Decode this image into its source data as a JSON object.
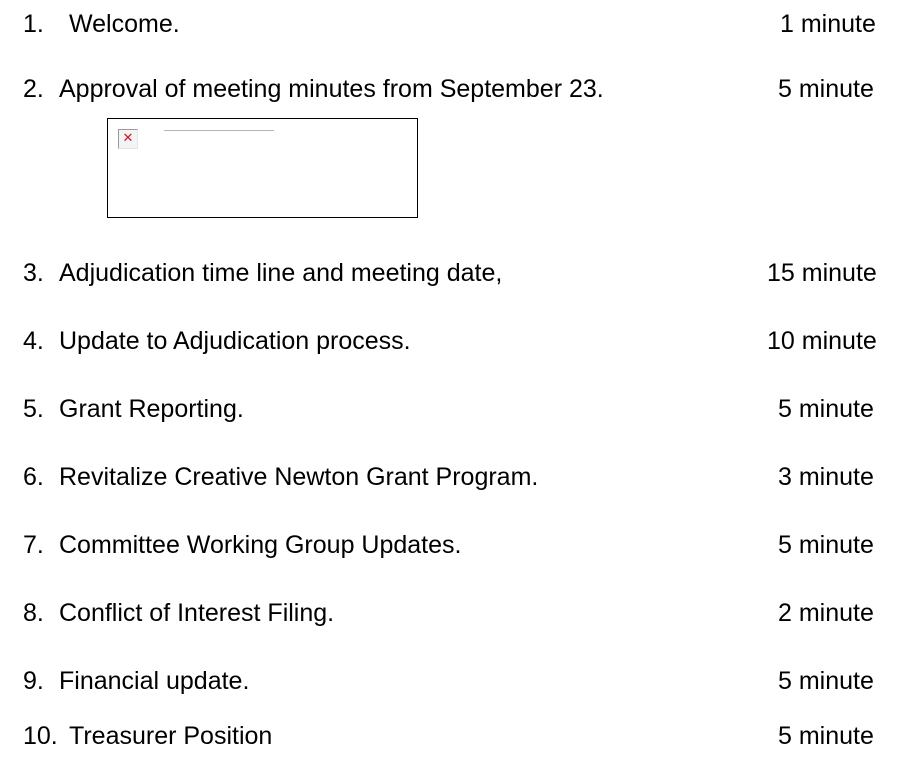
{
  "agenda": [
    {
      "number": "1.",
      "title": "Welcome.",
      "duration": "1 minute"
    },
    {
      "number": "2.",
      "title": "Approval of meeting minutes from September 23.",
      "duration": "5 minute"
    },
    {
      "number": "3.",
      "title": "Adjudication time line and meeting date,",
      "duration": "15 minute"
    },
    {
      "number": "4.",
      "title": "Update to Adjudication process.",
      "duration": "10 minute"
    },
    {
      "number": "5.",
      "title": "Grant Reporting.",
      "duration": "5 minute"
    },
    {
      "number": "6.",
      "title": "Revitalize Creative Newton Grant Program.",
      "duration": "3 minute"
    },
    {
      "number": "7.",
      "title": "Committee Working Group Updates.",
      "duration": "5 minute"
    },
    {
      "number": "8.",
      "title": "Conflict of Interest Filing.",
      "duration": "2 minute"
    },
    {
      "number": "9.",
      "title": "Financial update.",
      "duration": "5 minute"
    },
    {
      "number": "10.",
      "title": "Treasurer Position",
      "duration": "5 minute"
    }
  ],
  "broken_image": {
    "icon": "broken-image-x-icon",
    "icon_color": "#d0161c"
  }
}
